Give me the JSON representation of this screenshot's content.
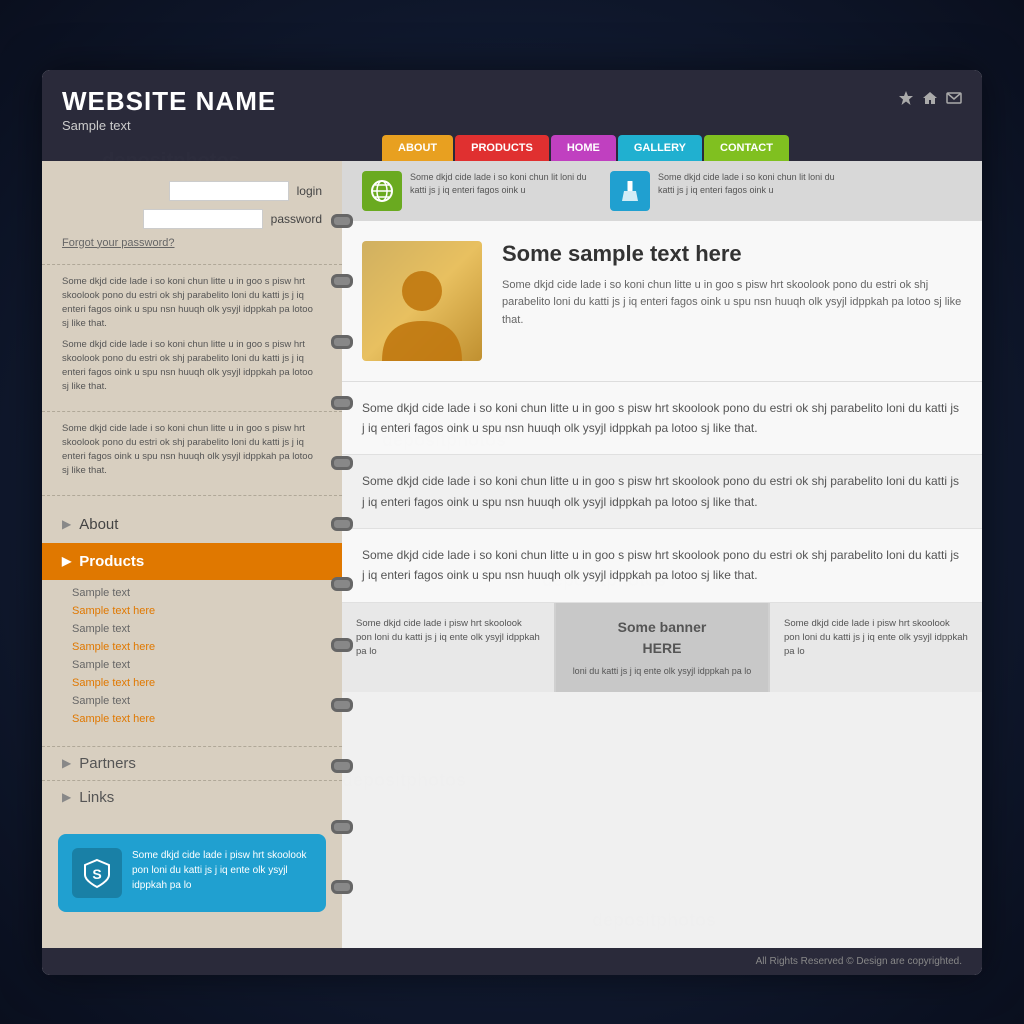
{
  "header": {
    "site_name": "WEBSITE NAME",
    "tagline": "Sample text"
  },
  "nav": {
    "items": [
      {
        "label": "ABOUT",
        "class": "nav-about"
      },
      {
        "label": "PRODUCTS",
        "class": "nav-products"
      },
      {
        "label": "HOME",
        "class": "nav-home"
      },
      {
        "label": "GALLERY",
        "class": "nav-gallery"
      },
      {
        "label": "CONTACT",
        "class": "nav-contact"
      }
    ]
  },
  "sidebar": {
    "login": {
      "login_label": "login",
      "password_label": "password",
      "forgot": "Forgot your password?"
    },
    "text_block1_p1": "Some dkjd  cide lade i so koni chun litte u in goo s pisw hrt skoolook pono du estri ok shj parabelito loni du katti js j iq enteri fagos oink u spu nsn huuqh olk ysyjl idppkah pa lotoo sj like that.",
    "text_block1_p2": "Some dkjd  cide lade i so koni chun litte u in goo s pisw hrt skoolook pono du estri ok shj parabelito loni du katti js j iq enteri fagos oink u spu nsn huuqh olk ysyjl idppkah pa lotoo sj like that.",
    "text_block2": "Some dkjd  cide lade i so koni chun litte u in goo s pisw hrt skoolook pono du estri ok shj parabelito loni du katti js j iq enteri fagos oink u spu nsn huuqh olk ysyjl idppkah pa lotoo sj like that.",
    "nav_items": [
      {
        "label": "About",
        "active": false
      },
      {
        "label": "Products",
        "active": true
      }
    ],
    "subnav": [
      "Sample text",
      "Sample text here",
      "Sample text",
      "Sample text here",
      "Sample text",
      "Sample text here",
      "Sample text",
      "Sample text here"
    ],
    "extra_nav": [
      {
        "label": "Partners"
      },
      {
        "label": "Links"
      }
    ],
    "badge_text": "Some dkjd  cide lade i pisw hrt skoolook pon loni du katti js j iq ente olk ysyjl idppkah pa lo"
  },
  "main": {
    "feature1_text": "Some dkjd  cide lade i so koni chun lit loni du katti js j iq enteri fagos oink u",
    "feature2_text": "Some dkjd  cide lade i so koni chun lit loni du katti js j iq enteri fagos oink u",
    "profile_title": "Some sample text here",
    "profile_text": "Some dkjd  cide lade i so koni chun litte u in goo s pisw hrt skoolook pono du estri ok shj parabelito loni du katti js j iq enteri fagos oink u spu nsn huuqh olk ysyjl idppkah pa lotoo sj like that.",
    "blocks": [
      "Some dkjd  cide lade i so koni chun litte u in goo s pisw hrt skoolook pono du estri ok shj parabelito loni du katti js j iq enteri fagos oink u spu nsn huuqh olk ysyjl idppkah pa lotoo sj like that.",
      "Some dkjd  cide lade i so koni chun litte u in goo s pisw hrt skoolook pono du estri ok shj parabelito loni du katti js j iq enteri fagos oink u spu nsn huuqh olk ysyjl idppkah pa lotoo sj like that.",
      "Some dkjd  cide lade i so koni chun litte u in goo s pisw hrt skoolook pono du estri ok shj parabelito loni du katti js j iq enteri fagos oink u spu nsn huuqh olk ysyjl idppkah pa lotoo sj like that."
    ],
    "banners": [
      {
        "text": "Some dkjd  cide lade i pisw hrt skoolook pon loni du katti js j iq ente olk ysyjl idppkah pa lo"
      },
      {
        "text": "Some banner\nHERE",
        "sub": "loni du katti js j iq ente olk ysyjl idppkah pa lo",
        "center": true
      },
      {
        "text": "Some dkjd  cide lade i pisw hrt skoolook pon loni du katti js j iq ente olk ysyjl idppkah pa lo"
      }
    ]
  },
  "footer": {
    "text": "All Rights Reserved ©  Design are copyrighted."
  }
}
